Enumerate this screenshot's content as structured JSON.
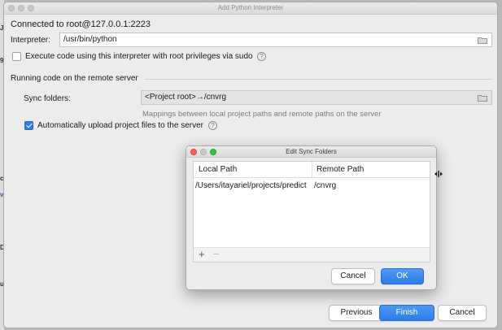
{
  "window": {
    "title": "Add Python Interpreter"
  },
  "connection": {
    "text": "Connected to root@127.0.0.1:2223"
  },
  "interpreter": {
    "label": "Interpreter:",
    "value": "/usr/bin/python"
  },
  "sudo_option": {
    "label": "Execute code using this interpreter with root privileges via sudo",
    "checked": false
  },
  "remote_section": {
    "heading": "Running code on the remote server"
  },
  "sync_folders": {
    "label": "Sync folders:",
    "value": "<Project root>→/cnvrg",
    "hint": "Mappings between local project paths and remote paths on the server"
  },
  "auto_upload": {
    "label": "Automatically upload project files to the server",
    "checked": true
  },
  "help_glyph": "?",
  "edit_sync_dialog": {
    "title": "Edit Sync Folders",
    "columns": [
      "Local Path",
      "Remote Path"
    ],
    "rows": [
      {
        "local": "/Users/itayariel/projects/predict",
        "remote": "/cnvrg"
      }
    ],
    "add_glyph": "+",
    "remove_glyph": "−",
    "cancel_label": "Cancel",
    "ok_label": "OK"
  },
  "footer": {
    "previous_label": "Previous",
    "finish_label": "Finish",
    "cancel_label": "Cancel"
  },
  "colors": {
    "accent": "#2b7ae8",
    "window_bg": "#ececec",
    "desktop_bg": "#b8b8b8"
  },
  "icons": [
    "folder-icon",
    "help-icon",
    "checkbox-icon",
    "add-icon",
    "remove-icon",
    "resize-cursor-icon"
  ]
}
